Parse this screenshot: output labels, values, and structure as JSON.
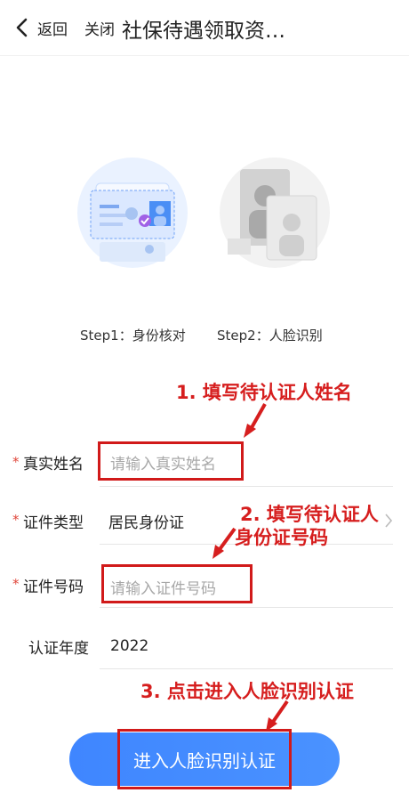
{
  "header": {
    "back_label": "返回",
    "close_label": "关闭",
    "title": "社保待遇领取资…"
  },
  "steps": [
    {
      "label": "Step1：身份核对"
    },
    {
      "label": "Step2：人脸识别"
    }
  ],
  "form": {
    "name": {
      "label": "真实姓名",
      "placeholder": "请输入真实姓名"
    },
    "id_type": {
      "label": "证件类型",
      "value": "居民身份证"
    },
    "id_number": {
      "label": "证件号码",
      "placeholder": "请输入证件号码"
    },
    "year": {
      "label": "认证年度",
      "value": "2022"
    }
  },
  "annotations": {
    "a1": "1. 填写待认证人姓名",
    "a2_line1": "2. 填写待认证人",
    "a2_line2": "身份证号码",
    "a3": "3. 点击进入人脸识别认证"
  },
  "button": {
    "label": "进入人脸识别认证"
  },
  "colors": {
    "accent": "#3f86ff",
    "annotation_red": "#d61e1e",
    "required": "#e0463a"
  }
}
